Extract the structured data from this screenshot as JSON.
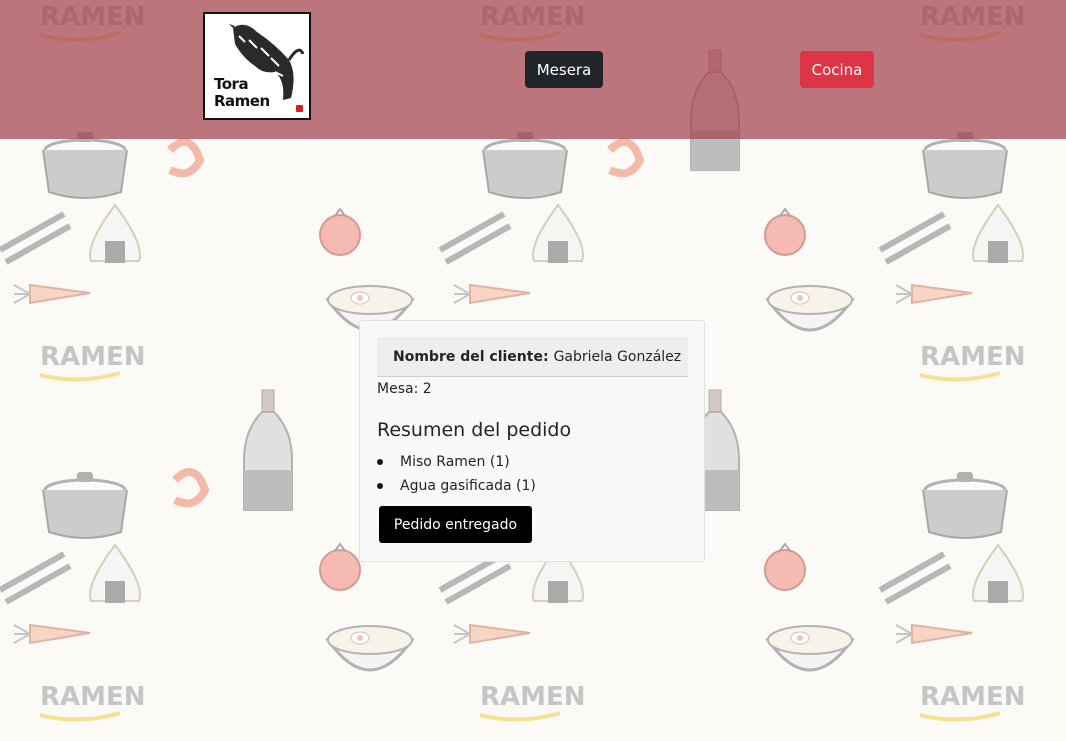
{
  "header": {
    "logo": {
      "text_line1": "Tora",
      "text_line2": "Ramen",
      "icon": "tiger-icon"
    },
    "nav": {
      "waiter_label": "Mesera",
      "kitchen_label": "Cocina"
    }
  },
  "order_card": {
    "customer_label": "Nombre del cliente:",
    "customer_name": "Gabriela González",
    "table_text": "Mesa: 2",
    "summary_title": "Resumen del pedido",
    "items": [
      "Miso Ramen (1)",
      "Agua gasificada (1)"
    ],
    "delivered_label": "Pedido entregado"
  },
  "background": {
    "watermark_text": "RAMEN"
  },
  "colors": {
    "header": "#a3414c",
    "waiter_button": "#212529",
    "kitchen_button": "#dc3545",
    "delivered_button": "#000000",
    "card": "#f8f9fa"
  }
}
